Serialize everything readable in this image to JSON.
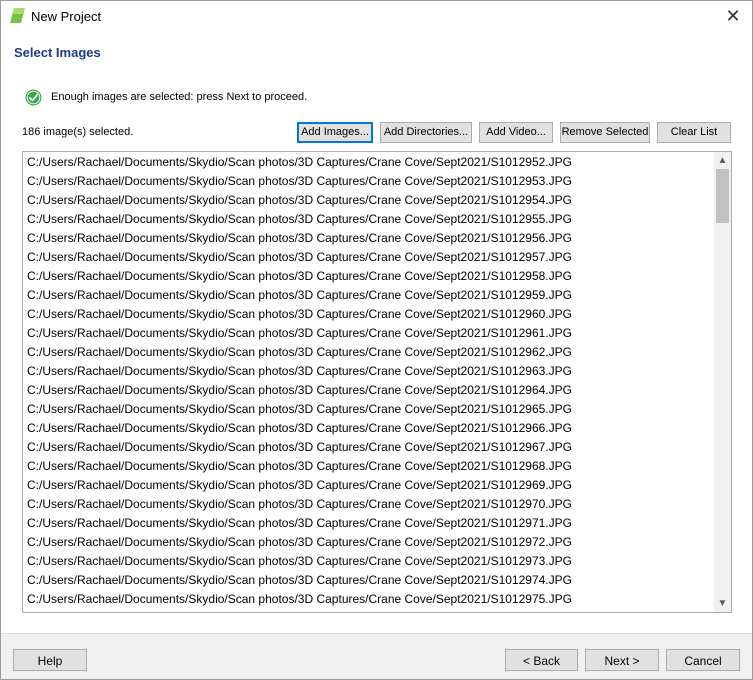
{
  "window": {
    "title": "New Project",
    "close_glyph": "✕"
  },
  "section": {
    "title": "Select Images"
  },
  "status": {
    "message": "Enough images are selected: press Next to proceed.",
    "icon": "check-circle-icon",
    "icon_color": "#3aa64a"
  },
  "selection": {
    "count_text": "186 image(s) selected."
  },
  "toolbar": {
    "add_images": "Add Images...",
    "add_directories": "Add Directories...",
    "add_video": "Add Video...",
    "remove_selected": "Remove Selected",
    "clear_list": "Clear List"
  },
  "files": [
    "C:/Users/Rachael/Documents/Skydio/Scan photos/3D Captures/Crane Cove/Sept2021/S1012952.JPG",
    "C:/Users/Rachael/Documents/Skydio/Scan photos/3D Captures/Crane Cove/Sept2021/S1012953.JPG",
    "C:/Users/Rachael/Documents/Skydio/Scan photos/3D Captures/Crane Cove/Sept2021/S1012954.JPG",
    "C:/Users/Rachael/Documents/Skydio/Scan photos/3D Captures/Crane Cove/Sept2021/S1012955.JPG",
    "C:/Users/Rachael/Documents/Skydio/Scan photos/3D Captures/Crane Cove/Sept2021/S1012956.JPG",
    "C:/Users/Rachael/Documents/Skydio/Scan photos/3D Captures/Crane Cove/Sept2021/S1012957.JPG",
    "C:/Users/Rachael/Documents/Skydio/Scan photos/3D Captures/Crane Cove/Sept2021/S1012958.JPG",
    "C:/Users/Rachael/Documents/Skydio/Scan photos/3D Captures/Crane Cove/Sept2021/S1012959.JPG",
    "C:/Users/Rachael/Documents/Skydio/Scan photos/3D Captures/Crane Cove/Sept2021/S1012960.JPG",
    "C:/Users/Rachael/Documents/Skydio/Scan photos/3D Captures/Crane Cove/Sept2021/S1012961.JPG",
    "C:/Users/Rachael/Documents/Skydio/Scan photos/3D Captures/Crane Cove/Sept2021/S1012962.JPG",
    "C:/Users/Rachael/Documents/Skydio/Scan photos/3D Captures/Crane Cove/Sept2021/S1012963.JPG",
    "C:/Users/Rachael/Documents/Skydio/Scan photos/3D Captures/Crane Cove/Sept2021/S1012964.JPG",
    "C:/Users/Rachael/Documents/Skydio/Scan photos/3D Captures/Crane Cove/Sept2021/S1012965.JPG",
    "C:/Users/Rachael/Documents/Skydio/Scan photos/3D Captures/Crane Cove/Sept2021/S1012966.JPG",
    "C:/Users/Rachael/Documents/Skydio/Scan photos/3D Captures/Crane Cove/Sept2021/S1012967.JPG",
    "C:/Users/Rachael/Documents/Skydio/Scan photos/3D Captures/Crane Cove/Sept2021/S1012968.JPG",
    "C:/Users/Rachael/Documents/Skydio/Scan photos/3D Captures/Crane Cove/Sept2021/S1012969.JPG",
    "C:/Users/Rachael/Documents/Skydio/Scan photos/3D Captures/Crane Cove/Sept2021/S1012970.JPG",
    "C:/Users/Rachael/Documents/Skydio/Scan photos/3D Captures/Crane Cove/Sept2021/S1012971.JPG",
    "C:/Users/Rachael/Documents/Skydio/Scan photos/3D Captures/Crane Cove/Sept2021/S1012972.JPG",
    "C:/Users/Rachael/Documents/Skydio/Scan photos/3D Captures/Crane Cove/Sept2021/S1012973.JPG",
    "C:/Users/Rachael/Documents/Skydio/Scan photos/3D Captures/Crane Cove/Sept2021/S1012974.JPG",
    "C:/Users/Rachael/Documents/Skydio/Scan photos/3D Captures/Crane Cove/Sept2021/S1012975.JPG"
  ],
  "footer": {
    "help": "Help",
    "back": "< Back",
    "next": "Next >",
    "cancel": "Cancel"
  },
  "colors": {
    "section_title": "#1d3c86",
    "focus_border": "#0078d7"
  }
}
